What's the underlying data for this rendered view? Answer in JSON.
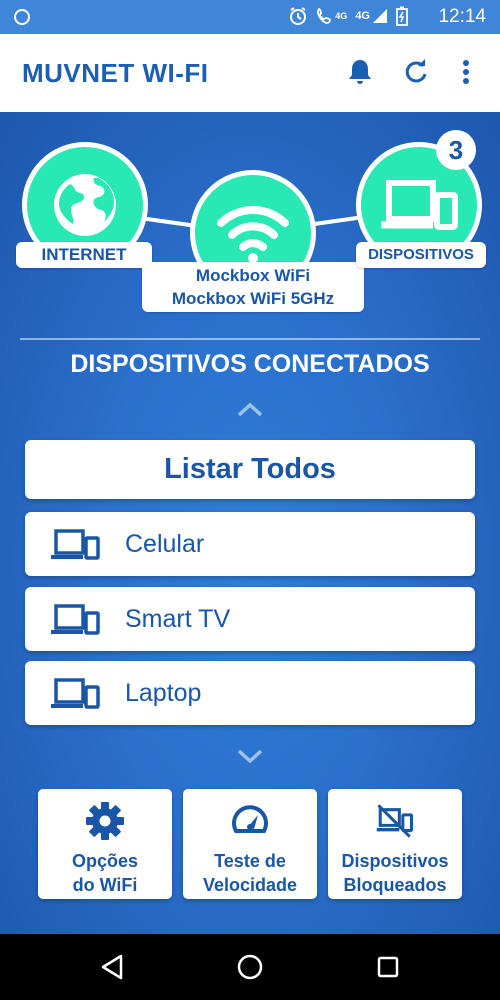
{
  "status_bar": {
    "network_label_1": "4G",
    "network_label_2": "4G",
    "time": "12:14"
  },
  "app_bar": {
    "title": "MUVNET WI-FI",
    "icons": [
      "bell-icon",
      "refresh-icon",
      "more-vert-icon"
    ]
  },
  "topology": {
    "internet_label": "INTERNET",
    "devices_label": "DISPOSITIVOS",
    "devices_count": "3",
    "wifi_networks": [
      "Mockbox WiFi",
      "Mockbox WiFi 5GHz"
    ]
  },
  "connected": {
    "title": "DISPOSITIVOS CONECTADOS",
    "list_all_label": "Listar Todos",
    "devices": [
      {
        "label": "Celular"
      },
      {
        "label": "Smart TV"
      },
      {
        "label": "Laptop"
      }
    ]
  },
  "actions": [
    {
      "line1": "Opções",
      "line2": "do WiFi",
      "icon": "gear-icon"
    },
    {
      "line1": "Teste de",
      "line2": "Velocidade",
      "icon": "speedometer-icon"
    },
    {
      "line1": "Dispositivos",
      "line2": "Bloqueados",
      "icon": "blocked-devices-icon"
    }
  ],
  "colors": {
    "primary": "#1a56a8",
    "accent": "#28e8b4",
    "background": "#2a6fcb"
  }
}
